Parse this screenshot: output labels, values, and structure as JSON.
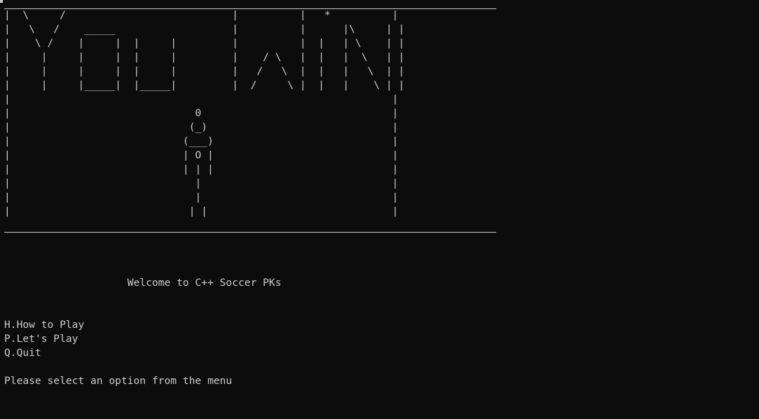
{
  "banner": {
    "art": "|  \\     /                           |          |   *          |\n|   \\   /    _____                   |          |      |\\     | |\n|    \\ /    |     |  |     |         |          |  |   | \\    | |\n|     |     |     |  |     |         |    / \\   |  |   |  \\   | |\n|     |     |     |  |     |         |   /   \\  |  |   |   \\  | |\n|     |     |_____|  |_____|         |  /     \\ |  |   |    \\ | |\n|                                                              |\n|                              0                               |\n|                             (_)                              |\n|                            (___)                             |\n|                            | O |                             |\n|                            | | |                             |\n|                              |                               |\n|                              |                               |\n|                             | |                              |"
  },
  "menu": {
    "welcome": "                    Welcome to C++ Soccer PKs",
    "option_how_to_play": "H.How to Play",
    "option_lets_play": "P.Let's Play",
    "option_quit": "Q.Quit",
    "prompt": "Please select an option from the menu"
  }
}
